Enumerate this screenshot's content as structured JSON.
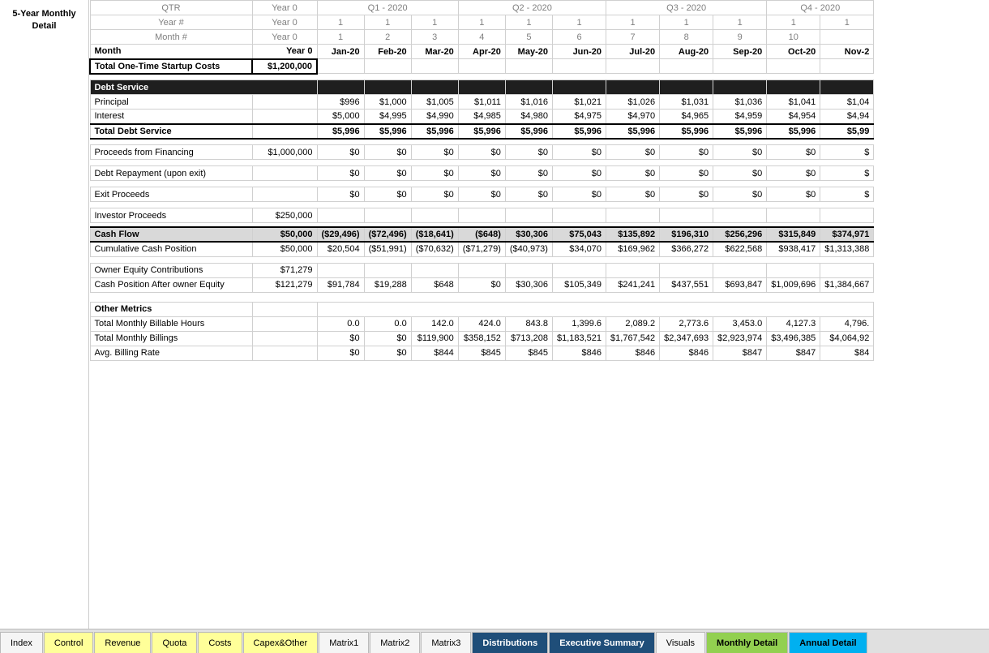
{
  "sidebar": {
    "label": "5-Year Monthly\nDetail"
  },
  "header": {
    "rows": [
      {
        "label": "QTR",
        "year0": "Year 0",
        "q1_2020_a": "Q1 - 2020",
        "q1_2020_b": "Q1 - 2020",
        "q1_2020_c": "Q1 - 2020",
        "q2_2020_a": "Q2 - 2020",
        "q2_2020_b": "Q2 - 2020",
        "q2_2020_c": "Q2 - 2020",
        "q3_2020_a": "Q3 - 2020",
        "q3_2020_b": "Q3 - 2020",
        "q3_2020_c": "Q3 - 2020",
        "q4_2020_a": "Q4 - 2020",
        "q4_2020_b": "Q4 - 202"
      },
      {
        "label": "Year #",
        "year0": "Year 0",
        "cols": [
          "1",
          "1",
          "1",
          "1",
          "1",
          "1",
          "1",
          "1",
          "1",
          "1",
          "1"
        ]
      },
      {
        "label": "Month #",
        "year0": "Year 0",
        "cols": [
          "1",
          "2",
          "3",
          "4",
          "5",
          "6",
          "7",
          "8",
          "9",
          "10",
          ""
        ]
      }
    ]
  },
  "columns": {
    "month_label": "Month",
    "year0": "Year 0",
    "months": [
      "Jan-20",
      "Feb-20",
      "Mar-20",
      "Apr-20",
      "May-20",
      "Jun-20",
      "Jul-20",
      "Aug-20",
      "Sep-20",
      "Oct-20",
      "Nov-2"
    ]
  },
  "total_startup": {
    "label": "Total One-Time Startup Costs",
    "year0": "$1,200,000",
    "months": [
      "",
      "",
      "",
      "",
      "",
      "",
      "",
      "",
      "",
      "",
      ""
    ]
  },
  "debt_service": {
    "section_label": "Debt Service",
    "principal": {
      "label": "Principal",
      "year0": "",
      "months": [
        "$996",
        "$1,000",
        "$1,005",
        "$1,011",
        "$1,016",
        "$1,021",
        "$1,026",
        "$1,031",
        "$1,036",
        "$1,041",
        "$1,04"
      ]
    },
    "interest": {
      "label": "Interest",
      "year0": "",
      "months": [
        "$5,000",
        "$4,995",
        "$4,990",
        "$4,985",
        "$4,980",
        "$4,975",
        "$4,970",
        "$4,965",
        "$4,959",
        "$4,954",
        "$4,94"
      ]
    },
    "total": {
      "label": "Total Debt Service",
      "year0": "",
      "months": [
        "$5,996",
        "$5,996",
        "$5,996",
        "$5,996",
        "$5,996",
        "$5,996",
        "$5,996",
        "$5,996",
        "$5,996",
        "$5,996",
        "$5,99"
      ]
    }
  },
  "proceeds_financing": {
    "label": "Proceeds from Financing",
    "year0": "$1,000,000",
    "months": [
      "$0",
      "$0",
      "$0",
      "$0",
      "$0",
      "$0",
      "$0",
      "$0",
      "$0",
      "$0",
      "$"
    ]
  },
  "debt_repayment": {
    "label": "Debt Repayment (upon exit)",
    "year0": "",
    "months": [
      "$0",
      "$0",
      "$0",
      "$0",
      "$0",
      "$0",
      "$0",
      "$0",
      "$0",
      "$0",
      "$"
    ]
  },
  "exit_proceeds": {
    "label": "Exit Proceeds",
    "year0": "",
    "months": [
      "$0",
      "$0",
      "$0",
      "$0",
      "$0",
      "$0",
      "$0",
      "$0",
      "$0",
      "$0",
      "$"
    ]
  },
  "investor_proceeds": {
    "label": "Investor Proceeds",
    "year0": "$250,000",
    "months": [
      "",
      "",
      "",
      "",
      "",
      "",
      "",
      "",
      "",
      "",
      ""
    ]
  },
  "cash_flow": {
    "label": "Cash Flow",
    "year0": "$50,000",
    "months": [
      "($29,496)",
      "($72,496)",
      "($18,641)",
      "($648)",
      "$30,306",
      "$75,043",
      "$135,892",
      "$196,310",
      "$256,296",
      "$315,849",
      "$374,971"
    ]
  },
  "cumulative": {
    "label": "Cumulative Cash Position",
    "year0": "$50,000",
    "months": [
      "$20,504",
      "($51,991)",
      "($70,632)",
      "($71,279)",
      "($40,973)",
      "$34,070",
      "$169,962",
      "$366,272",
      "$622,568",
      "$938,417",
      "$1,313,388"
    ]
  },
  "owner_equity": {
    "label": "Owner Equity Contributions",
    "year0": "$71,279",
    "months": [
      "",
      "",
      "",
      "",
      "",
      "",
      "",
      "",
      "",
      "",
      ""
    ]
  },
  "cash_after_equity": {
    "label": "Cash Position After owner Equity",
    "year0": "$121,279",
    "months": [
      "$91,784",
      "$19,288",
      "$648",
      "$0",
      "$30,306",
      "$105,349",
      "$241,241",
      "$437,551",
      "$693,847",
      "$1,009,696",
      "$1,384,667"
    ]
  },
  "other_metrics": {
    "section_label": "Other Metrics",
    "billable_hours": {
      "label": "Total Monthly Billable Hours",
      "year0": "",
      "months": [
        "0.0",
        "0.0",
        "142.0",
        "424.0",
        "843.8",
        "1,399.6",
        "2,089.2",
        "2,773.6",
        "3,453.0",
        "4,127.3",
        "4,796."
      ]
    },
    "billings": {
      "label": "Total Monthly Billings",
      "year0": "",
      "months": [
        "$0",
        "$0",
        "$119,900",
        "$358,152",
        "$713,208",
        "$1,183,521",
        "$1,767,542",
        "$2,347,693",
        "$2,923,974",
        "$3,496,385",
        "$4,064,92"
      ]
    },
    "avg_billing_rate": {
      "label": "Avg. Billing Rate",
      "year0": "",
      "months": [
        "$0",
        "$0",
        "$844",
        "$845",
        "$845",
        "$846",
        "$846",
        "$846",
        "$847",
        "$847",
        "$84"
      ]
    }
  },
  "tabs": [
    {
      "id": "index",
      "label": "Index",
      "style": "normal"
    },
    {
      "id": "control",
      "label": "Control",
      "style": "yellow"
    },
    {
      "id": "revenue",
      "label": "Revenue",
      "style": "yellow"
    },
    {
      "id": "quota",
      "label": "Quota",
      "style": "yellow"
    },
    {
      "id": "costs",
      "label": "Costs",
      "style": "yellow"
    },
    {
      "id": "capex",
      "label": "Capex&Other",
      "style": "yellow"
    },
    {
      "id": "matrix1",
      "label": "Matrix1",
      "style": "normal"
    },
    {
      "id": "matrix2",
      "label": "Matrix2",
      "style": "normal"
    },
    {
      "id": "matrix3",
      "label": "Matrix3",
      "style": "normal"
    },
    {
      "id": "distributions",
      "label": "Distributions",
      "style": "active-dark"
    },
    {
      "id": "executive",
      "label": "Executive Summary",
      "style": "active-dark"
    },
    {
      "id": "visuals",
      "label": "Visuals",
      "style": "normal"
    },
    {
      "id": "monthly",
      "label": "Monthly Detail",
      "style": "green-active"
    },
    {
      "id": "annual",
      "label": "Annual Detail",
      "style": "blue-active"
    }
  ]
}
